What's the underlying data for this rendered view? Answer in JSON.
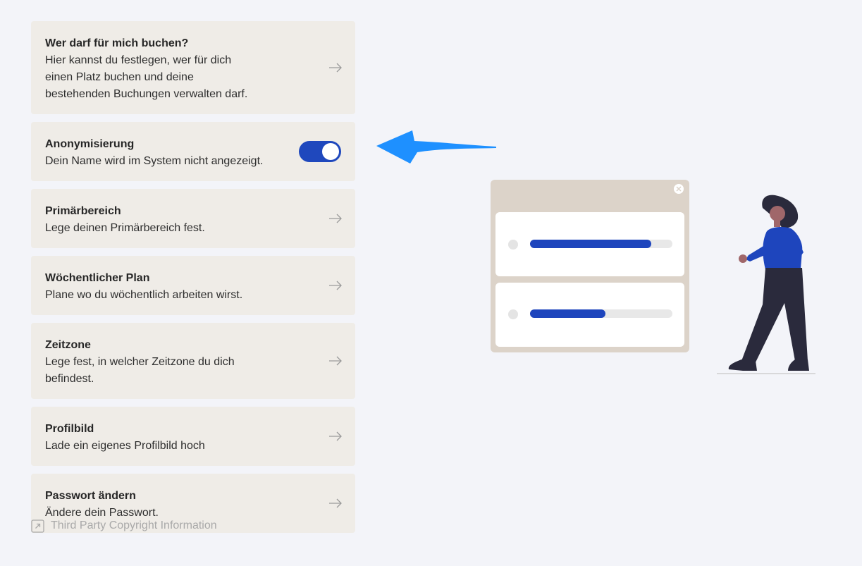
{
  "settings": [
    {
      "title": "Wer darf für mich buchen?",
      "description": "Hier kannst du festlegen, wer für dich\neinen Platz buchen und deine\nbestehenden Buchungen verwalten darf.",
      "control": "arrow-right-icon"
    },
    {
      "title": "Anonymisierung",
      "description": "Dein Name wird im System nicht angezeigt.",
      "control": "toggle",
      "toggle_on": true
    },
    {
      "title": "Primärbereich",
      "description": "Lege deinen Primärbereich fest.",
      "control": "arrow-right-icon"
    },
    {
      "title": "Wöchentlicher Plan",
      "description": "Plane wo du wöchentlich arbeiten wirst.",
      "control": "arrow-right-icon"
    },
    {
      "title": "Zeitzone",
      "description": "Lege fest, in welcher Zeitzone du dich\nbefindest.",
      "control": "arrow-right-icon"
    },
    {
      "title": "Profilbild",
      "description": "Lade ein eigenes Profilbild hoch",
      "control": "arrow-right-icon"
    },
    {
      "title": "Passwort ändern",
      "description": "Ändere dein Passwort.",
      "control": "arrow-right-icon"
    }
  ],
  "footer": {
    "link_label": "Third Party Copyright Information",
    "icon": "external-link-icon"
  },
  "illustration": {
    "progress_bars": [
      0.85,
      0.53
    ]
  },
  "colors": {
    "background": "#f3f4f9",
    "card": "#efece7",
    "toggle_on": "#1f48bd",
    "annotation_arrow": "#1e90ff",
    "progress_fill": "#1e45bd"
  }
}
